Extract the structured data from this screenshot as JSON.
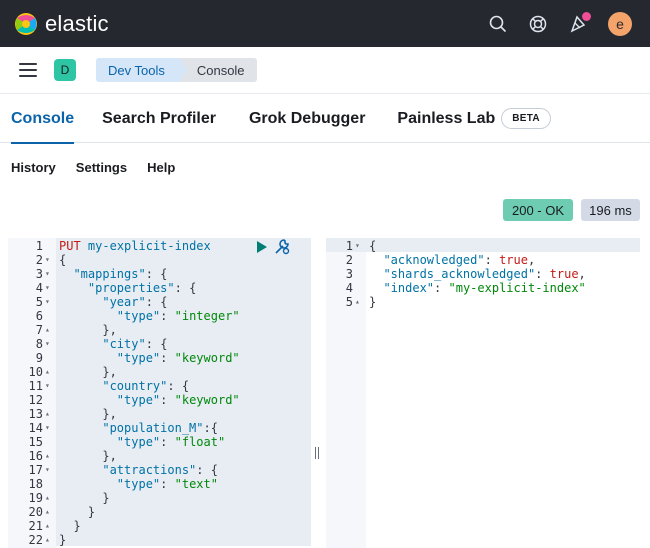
{
  "topbar": {
    "brand": "elastic",
    "avatar_initial": "e",
    "icons": [
      "search-icon",
      "help-icon",
      "notifications-icon"
    ]
  },
  "breadcrumbs": {
    "space_initial": "D",
    "items": [
      "Dev Tools",
      "Console"
    ]
  },
  "tabs": [
    {
      "label": "Console",
      "active": true
    },
    {
      "label": "Search Profiler",
      "active": false
    },
    {
      "label": "Grok Debugger",
      "active": false
    },
    {
      "label": "Painless Lab",
      "active": false,
      "badge": "BETA"
    }
  ],
  "subnav": [
    "History",
    "Settings",
    "Help"
  ],
  "status": {
    "code": "200 - OK",
    "time": "196 ms"
  },
  "request": {
    "method": "PUT",
    "path": "my-explicit-index",
    "lines": [
      "{",
      "  \"mappings\": {",
      "    \"properties\": {",
      "      \"year\": {",
      "        \"type\": \"integer\"",
      "      },",
      "      \"city\": {",
      "        \"type\": \"keyword\"",
      "      },",
      "      \"country\": {",
      "        \"type\": \"keyword\"",
      "      },",
      "      \"population_M\":{",
      "        \"type\": \"float\"",
      "      },",
      "      \"attractions\": {",
      "        \"type\": \"text\"",
      "      }",
      "    }",
      "  }",
      "}"
    ]
  },
  "response": {
    "lines": [
      "{",
      "  \"acknowledged\": true,",
      "  \"shards_acknowledged\": true,",
      "  \"index\": \"my-explicit-index\"",
      "}"
    ]
  }
}
